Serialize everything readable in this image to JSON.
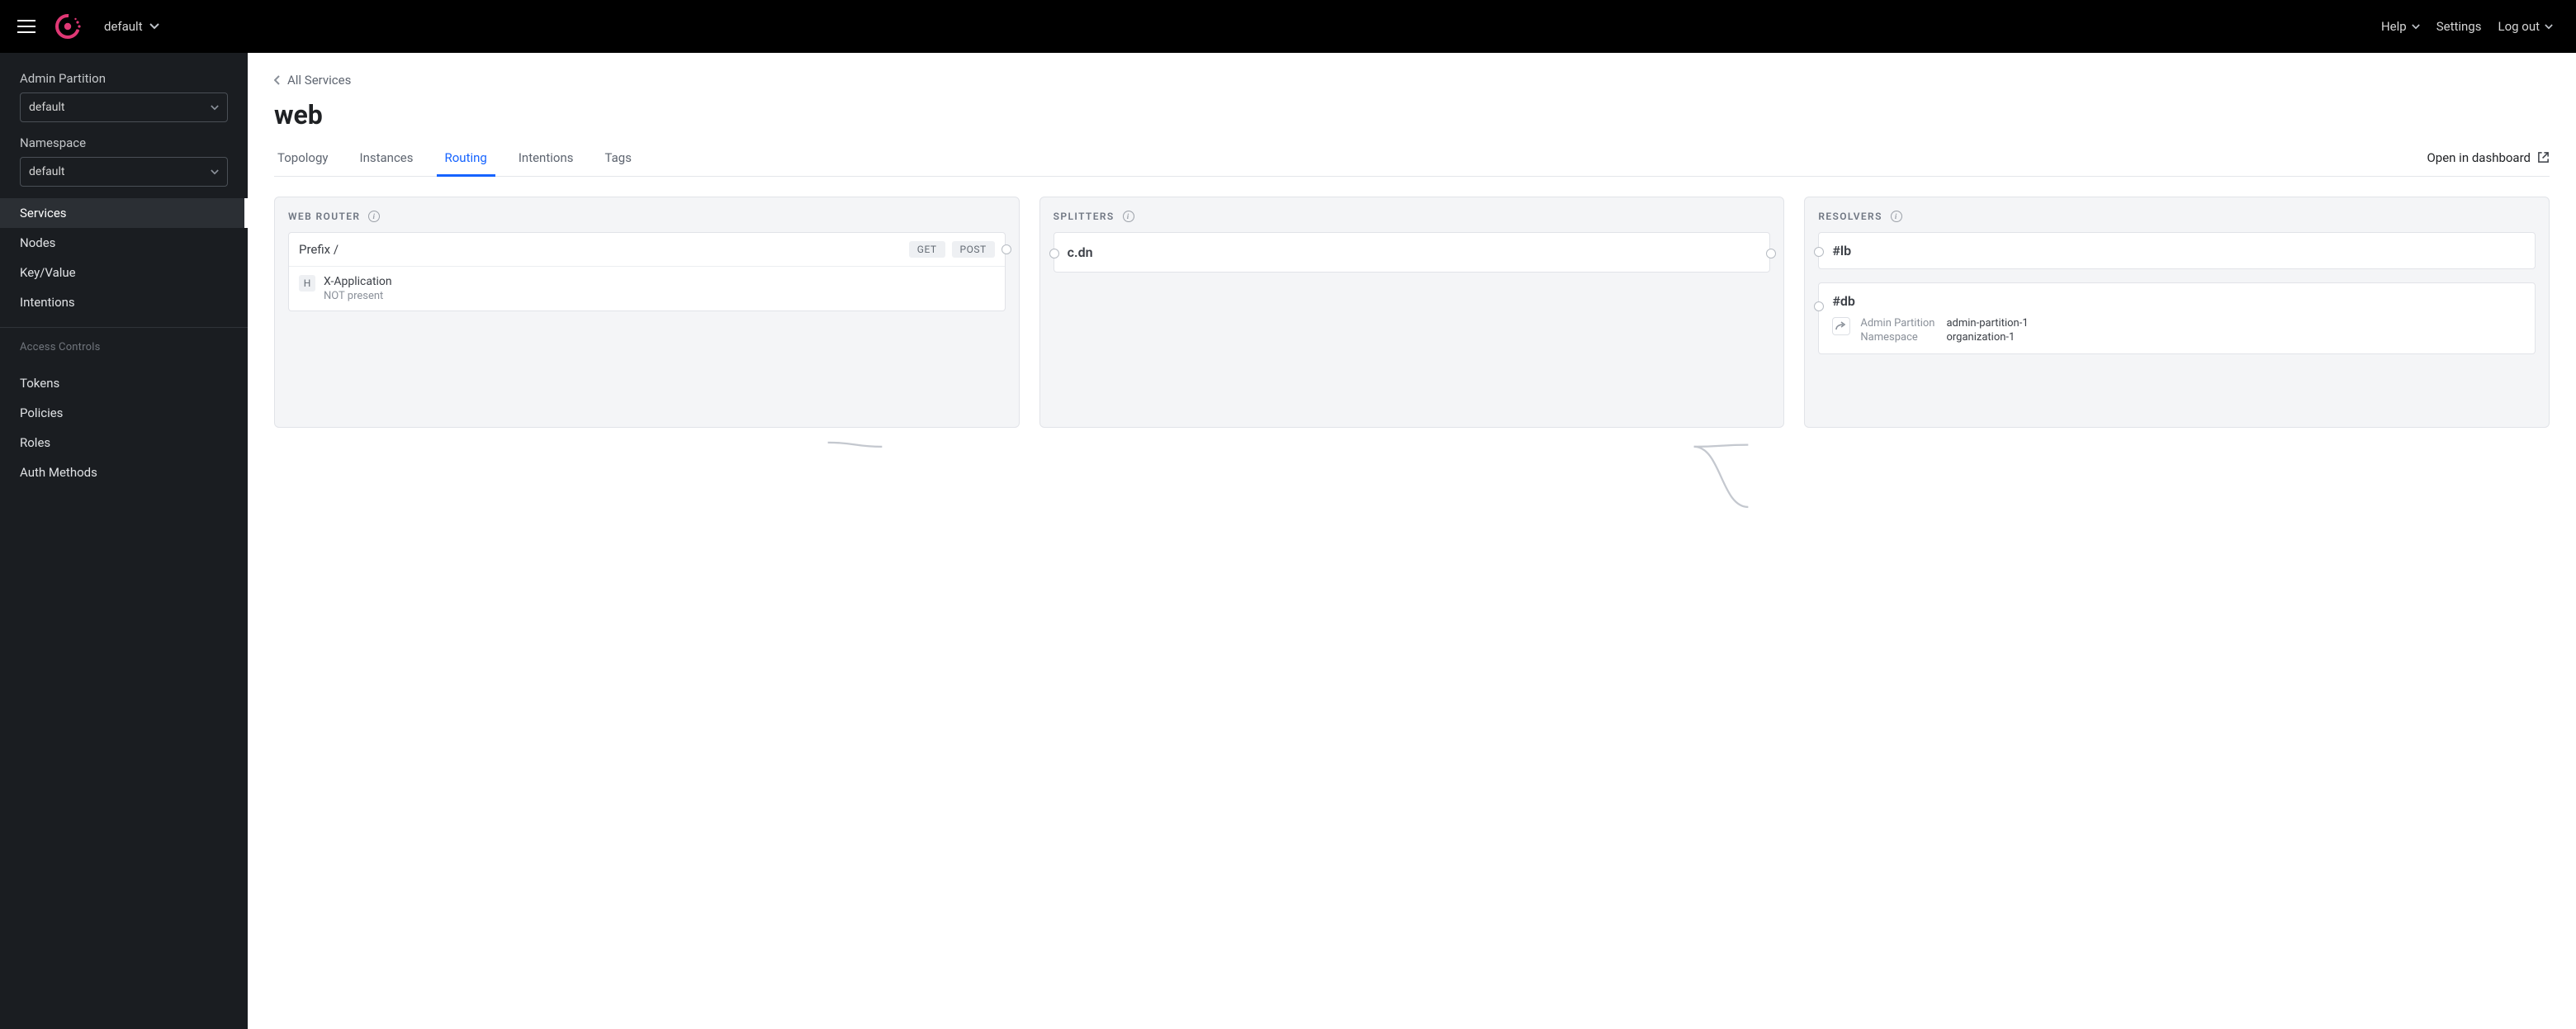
{
  "top": {
    "dc_label": "default",
    "help": "Help",
    "settings": "Settings",
    "logout": "Log out"
  },
  "sidebar": {
    "partition_label": "Admin Partition",
    "partition_value": "default",
    "namespace_label": "Namespace",
    "namespace_value": "default",
    "nav": {
      "services": "Services",
      "nodes": "Nodes",
      "kv": "Key/Value",
      "intentions": "Intentions"
    },
    "access_label": "Access Controls",
    "access": {
      "tokens": "Tokens",
      "policies": "Policies",
      "roles": "Roles",
      "auth": "Auth Methods"
    }
  },
  "page": {
    "breadcrumb": "All Services",
    "title": "web",
    "tabs": {
      "topology": "Topology",
      "instances": "Instances",
      "routing": "Routing",
      "intentions": "Intentions",
      "tags": "Tags"
    },
    "dashboard_link": "Open in dashboard"
  },
  "router": {
    "header": "WEB ROUTER",
    "route": {
      "prefix": "Prefix /",
      "methods": [
        "GET",
        "POST"
      ],
      "header_key": "X-Application",
      "header_cond": "NOT present",
      "header_badge": "H"
    }
  },
  "splitters": {
    "header": "SPLITTERS",
    "items": [
      {
        "label": "c.dn"
      }
    ]
  },
  "resolvers": {
    "header": "RESOLVERS",
    "items": [
      {
        "label": "#lb"
      },
      {
        "label": "#db",
        "redirect": {
          "partition_key": "Admin Partition",
          "partition_val": "admin-partition-1",
          "namespace_key": "Namespace",
          "namespace_val": "organization-1"
        }
      }
    ]
  }
}
